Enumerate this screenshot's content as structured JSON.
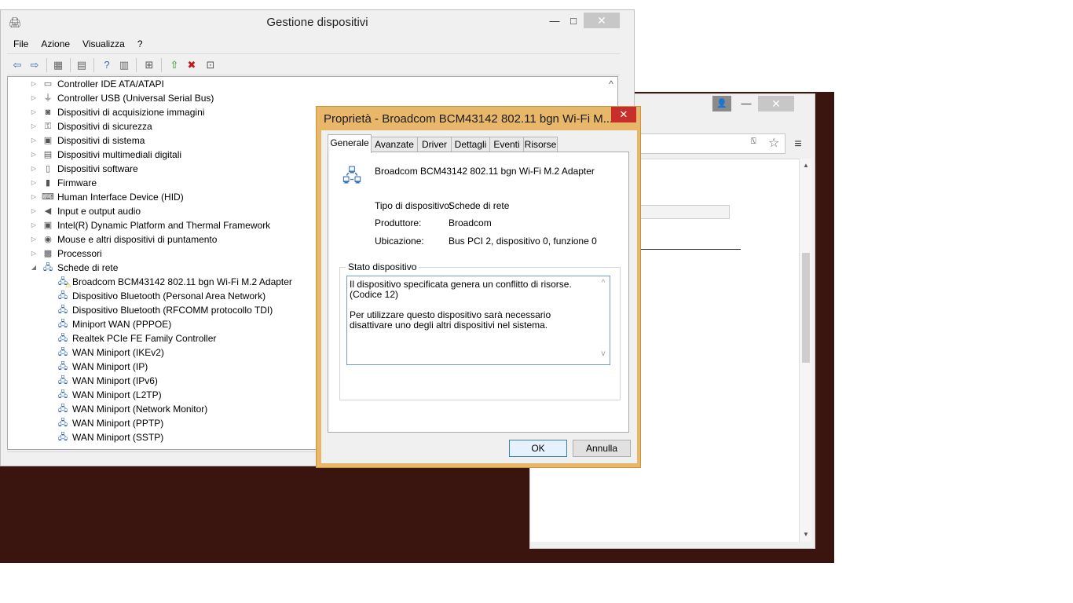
{
  "browser": {
    "avatar": "👤",
    "minimize": "—",
    "maximize": "□",
    "close": "✕",
    "menu": "≡",
    "scroll_up": "▲",
    "scroll_down": "▼"
  },
  "devmgr": {
    "title": "Gestione dispositivi",
    "minimize": "—",
    "maximize": "□",
    "close": "✕",
    "menu": [
      "File",
      "Azione",
      "Visualizza",
      "?"
    ],
    "scroll_up": "^",
    "tree": [
      {
        "label": "Controller IDE ATA/ATAPI",
        "expanded": false,
        "level": 0,
        "icon": "ide-controller-icon"
      },
      {
        "label": "Controller USB (Universal Serial Bus)",
        "expanded": false,
        "level": 0,
        "icon": "usb-icon"
      },
      {
        "label": "Dispositivi di acquisizione immagini",
        "expanded": false,
        "level": 0,
        "icon": "camera-icon"
      },
      {
        "label": "Dispositivi di sicurezza",
        "expanded": false,
        "level": 0,
        "icon": "key-icon"
      },
      {
        "label": "Dispositivi di sistema",
        "expanded": false,
        "level": 0,
        "icon": "system-icon"
      },
      {
        "label": "Dispositivi multimediali digitali",
        "expanded": false,
        "level": 0,
        "icon": "media-icon"
      },
      {
        "label": "Dispositivi software",
        "expanded": false,
        "level": 0,
        "icon": "software-device-icon"
      },
      {
        "label": "Firmware",
        "expanded": false,
        "level": 0,
        "icon": "firmware-icon"
      },
      {
        "label": "Human Interface Device (HID)",
        "expanded": false,
        "level": 0,
        "icon": "hid-icon"
      },
      {
        "label": "Input e output audio",
        "expanded": false,
        "level": 0,
        "icon": "speaker-icon"
      },
      {
        "label": "Intel(R) Dynamic Platform and Thermal Framework",
        "expanded": false,
        "level": 0,
        "icon": "intel-icon"
      },
      {
        "label": "Mouse e altri dispositivi di puntamento",
        "expanded": false,
        "level": 0,
        "icon": "mouse-icon"
      },
      {
        "label": "Processori",
        "expanded": false,
        "level": 0,
        "icon": "processor-icon"
      },
      {
        "label": "Schede di rete",
        "expanded": true,
        "level": 0,
        "icon": "network-icon"
      },
      {
        "label": "Broadcom BCM43142 802.11 bgn Wi-Fi M.2 Adapter",
        "level": 1,
        "icon": "network-warning-icon"
      },
      {
        "label": "Dispositivo Bluetooth (Personal Area Network)",
        "level": 1,
        "icon": "network-adapter-icon"
      },
      {
        "label": "Dispositivo Bluetooth (RFCOMM protocollo TDI)",
        "level": 1,
        "icon": "network-adapter-icon"
      },
      {
        "label": "Miniport WAN (PPPOE)",
        "level": 1,
        "icon": "network-adapter-icon"
      },
      {
        "label": "Realtek PCIe FE Family Controller",
        "level": 1,
        "icon": "network-adapter-icon"
      },
      {
        "label": "WAN Miniport (IKEv2)",
        "level": 1,
        "icon": "network-adapter-icon"
      },
      {
        "label": "WAN Miniport (IP)",
        "level": 1,
        "icon": "network-adapter-icon"
      },
      {
        "label": "WAN Miniport (IPv6)",
        "level": 1,
        "icon": "network-adapter-icon"
      },
      {
        "label": "WAN Miniport (L2TP)",
        "level": 1,
        "icon": "network-adapter-icon"
      },
      {
        "label": "WAN Miniport (Network Monitor)",
        "level": 1,
        "icon": "network-adapter-icon"
      },
      {
        "label": "WAN Miniport (PPTP)",
        "level": 1,
        "icon": "network-adapter-icon"
      },
      {
        "label": "WAN Miniport (SSTP)",
        "level": 1,
        "icon": "network-adapter-icon"
      }
    ]
  },
  "dialog": {
    "title": "Proprietà - Broadcom BCM43142 802.11 bgn Wi-Fi M...",
    "close": "✕",
    "tabs": [
      "Generale",
      "Avanzate",
      "Driver",
      "Dettagli",
      "Eventi",
      "Risorse"
    ],
    "device_name": "Broadcom BCM43142 802.11 bgn Wi-Fi M.2 Adapter",
    "type_label": "Tipo di dispositivo:",
    "type_value": "Schede di rete",
    "manufacturer_label": "Produttore:",
    "manufacturer_value": "Broadcom",
    "location_label": "Ubicazione:",
    "location_value": "Bus PCI 2, dispositivo 0, funzione 0",
    "status_group": "Stato dispositivo",
    "status_line1": "Il dispositivo specificata genera un conflitto di risorse. (Codice 12)",
    "status_line2": "Per utilizzare questo dispositivo sarà necessario disattivare uno degli altri dispositivi nel sistema.",
    "scroll_up": "^",
    "scroll_down": "v",
    "ok": "OK",
    "cancel": "Annulla"
  },
  "colors": {
    "dialog_frame": "#e8b76a",
    "close_red": "#c7302a",
    "desktop": "#3a1510"
  }
}
